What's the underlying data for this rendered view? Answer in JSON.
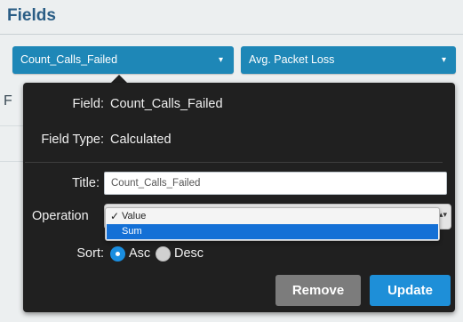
{
  "panel": {
    "title": "Fields"
  },
  "pills": [
    {
      "label": "Count_Calls_Failed",
      "caret": "▾"
    },
    {
      "label": "Avg. Packet Loss",
      "caret": "▾"
    }
  ],
  "background": {
    "partial_letter": "F"
  },
  "popover": {
    "field_label": "Field:",
    "field_value": "Count_Calls_Failed",
    "type_label": "Field Type:",
    "type_value": "Calculated",
    "title_label": "Title:",
    "title_value": "Count_Calls_Failed",
    "operation_label": "Operation",
    "operation_options": [
      {
        "label": "Value",
        "checked": true,
        "highlighted": false
      },
      {
        "label": "Sum",
        "checked": false,
        "highlighted": true
      }
    ],
    "sort_label": "Sort:",
    "sort_options": [
      {
        "label": "Asc",
        "selected": true
      },
      {
        "label": "Desc",
        "selected": false
      }
    ],
    "remove_label": "Remove",
    "update_label": "Update"
  },
  "colors": {
    "pill_bg": "#1e87b7",
    "popover_bg": "#202020",
    "update_bg": "#1e8fd8",
    "remove_bg": "#7c7c7c",
    "highlight": "#1470d6"
  },
  "icons": {
    "checkmark": "✓",
    "select_spinner": "▴▾"
  }
}
